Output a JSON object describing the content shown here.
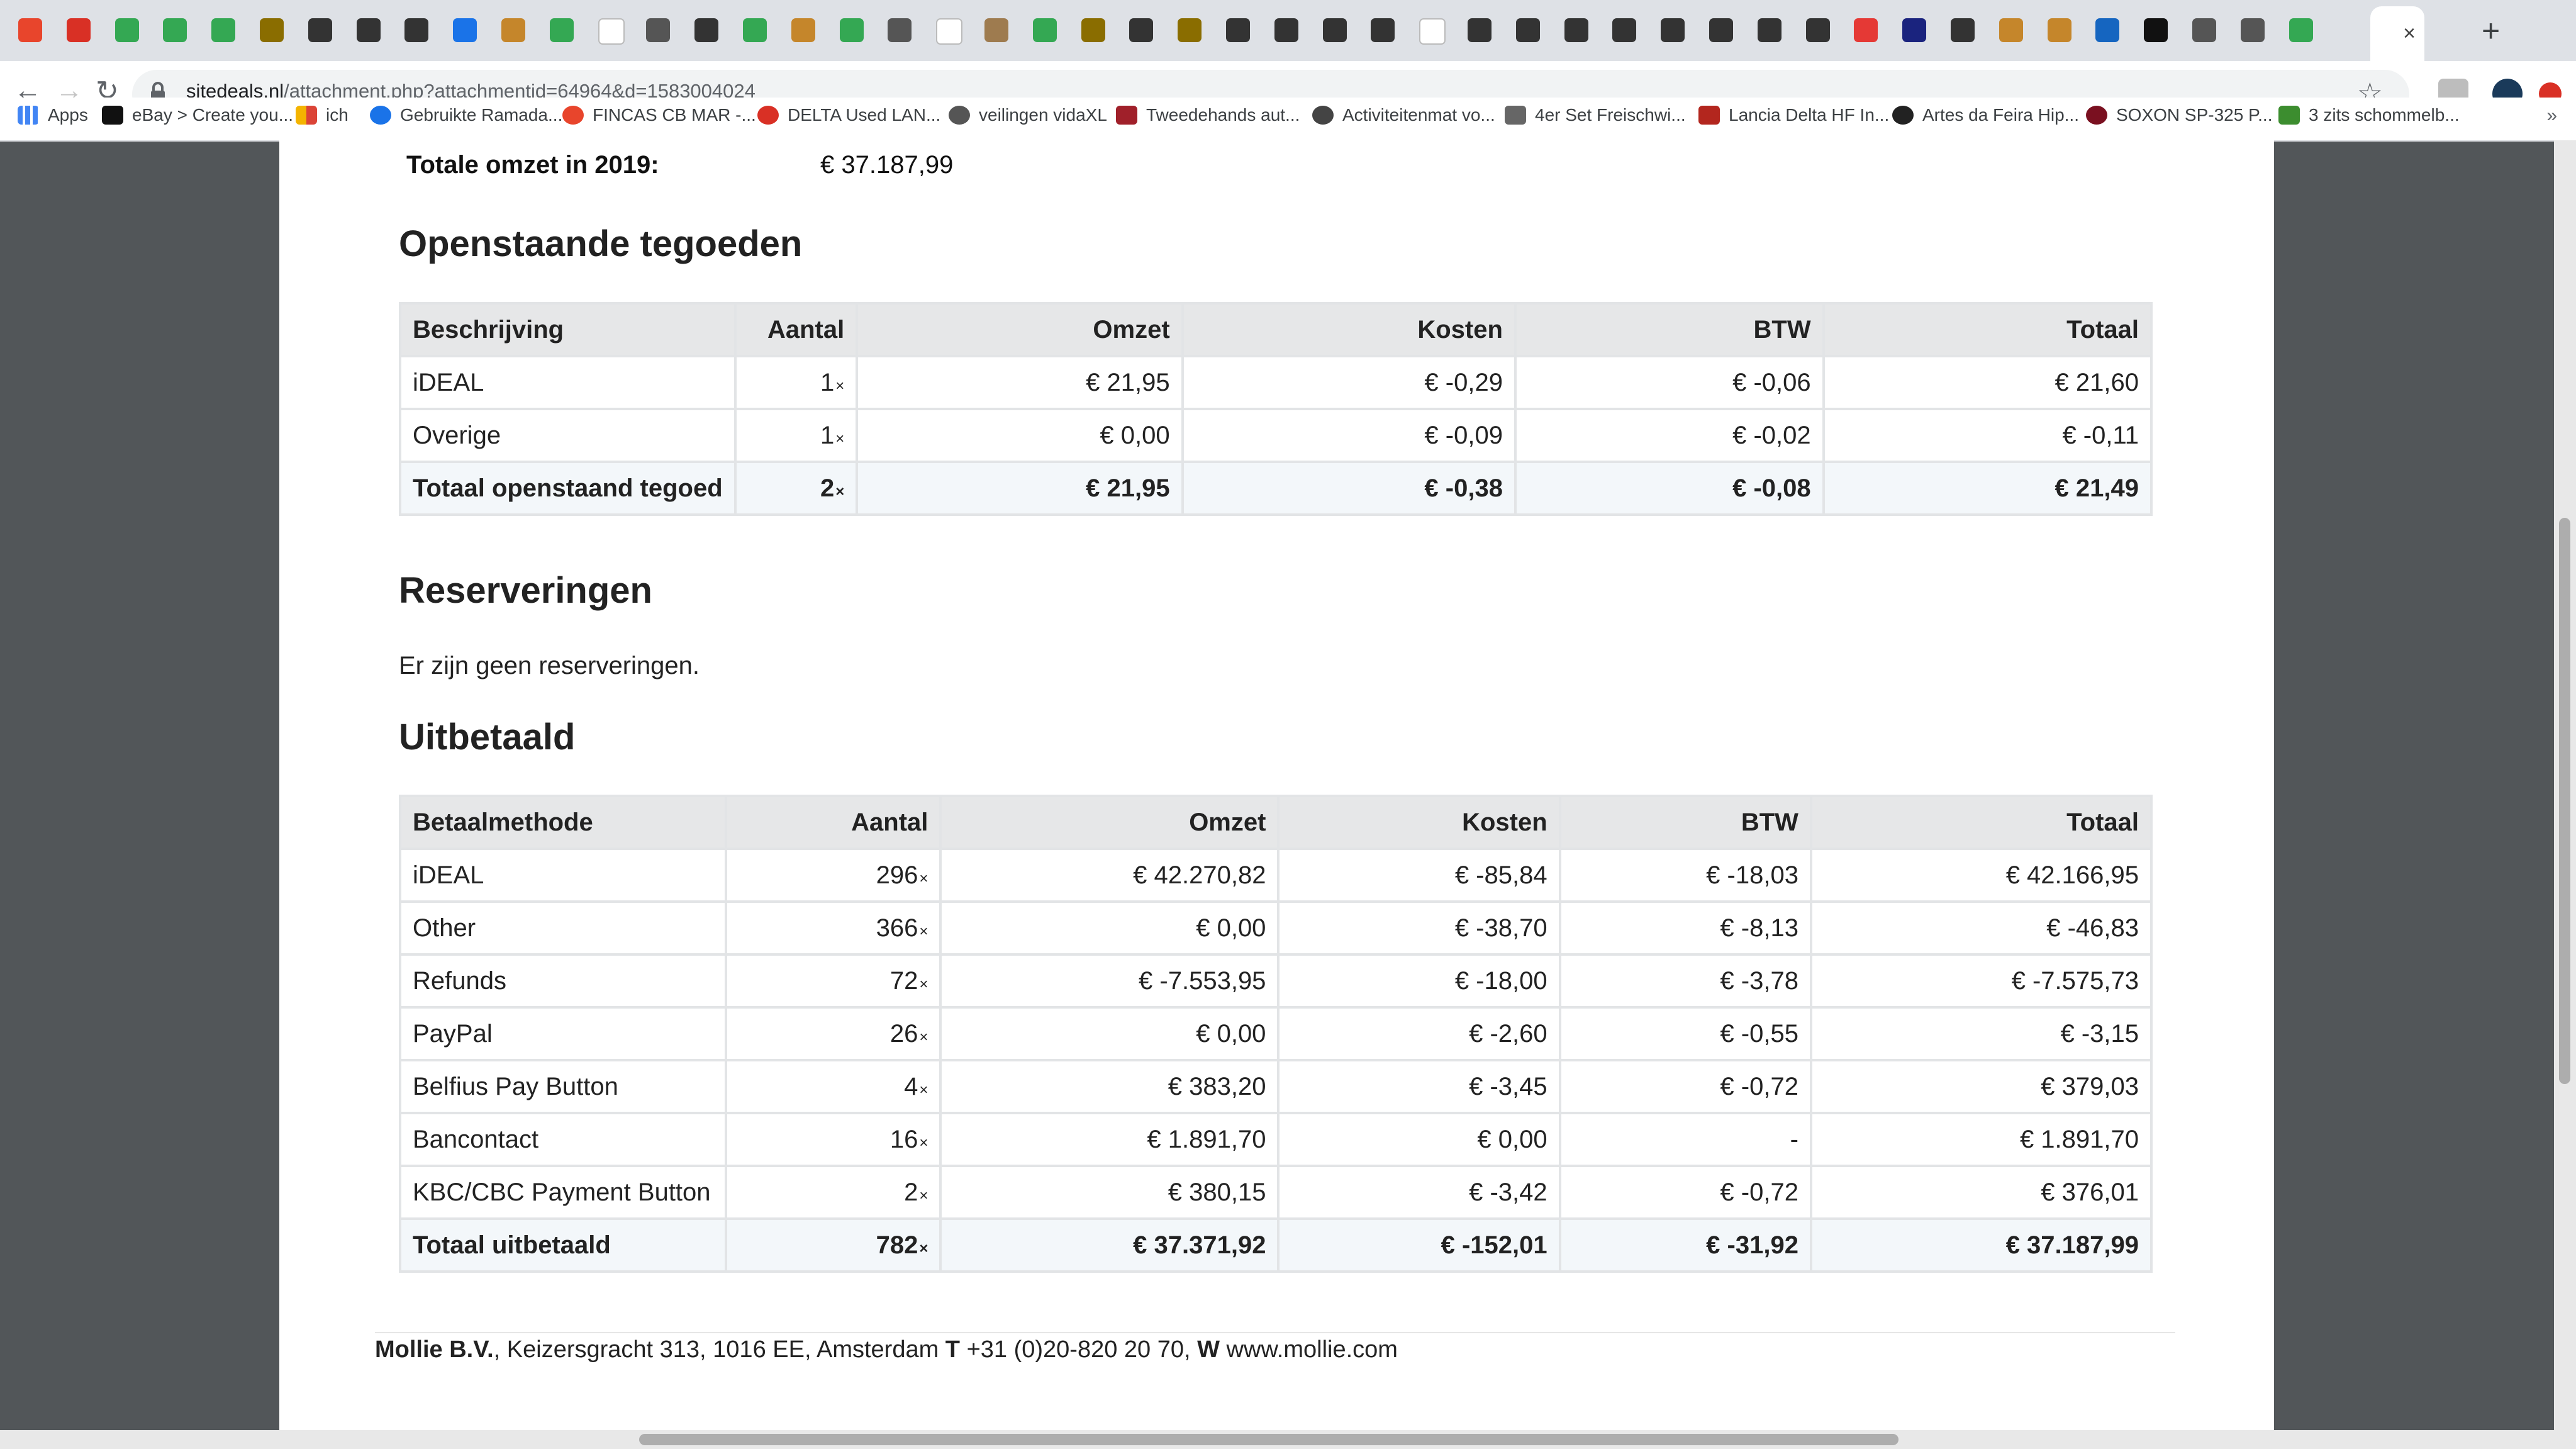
{
  "browser": {
    "active_tab_close": "×",
    "new_tab": "+",
    "url_domain": "sitedeals.nl",
    "url_path": "/attachment.php?attachmentid=64964&d=1583004024",
    "bookmarks": [
      "Apps",
      "eBay > Create you...",
      "ich",
      "Gebruikte Ramada...",
      "FINCAS CB MAR -...",
      "DELTA Used LAN...",
      "veilingen vidaXL",
      "Tweedehands aut...",
      "Activiteitenmat vo...",
      "4er Set Freischwi...",
      "Lancia Delta HF In...",
      "Artes da Feira Hip...",
      "SOXON SP-325 P...",
      "3 zits schommelb..."
    ],
    "bookmarks_more": "»"
  },
  "document": {
    "revenue_label": "Totale omzet in 2019:",
    "revenue_value": "€ 37.187,99",
    "outstanding": {
      "heading": "Openstaande tegoeden",
      "columns": [
        "Beschrijving",
        "Aantal",
        "Omzet",
        "Kosten",
        "BTW",
        "Totaal"
      ],
      "rows": [
        [
          "iDEAL",
          "1",
          "€ 21,95",
          "€ -0,29",
          "€ -0,06",
          "€ 21,60"
        ],
        [
          "Overige",
          "1",
          "€ 0,00",
          "€ -0,09",
          "€ -0,02",
          "€ -0,11"
        ]
      ],
      "total": [
        "Totaal openstaand tegoed",
        "2",
        "€ 21,95",
        "€ -0,38",
        "€ -0,08",
        "€ 21,49"
      ]
    },
    "reservations": {
      "heading": "Reserveringen",
      "text": "Er zijn geen reserveringen."
    },
    "paid": {
      "heading": "Uitbetaald",
      "columns": [
        "Betaalmethode",
        "Aantal",
        "Omzet",
        "Kosten",
        "BTW",
        "Totaal"
      ],
      "rows": [
        [
          "iDEAL",
          "296",
          "€ 42.270,82",
          "€ -85,84",
          "€ -18,03",
          "€ 42.166,95"
        ],
        [
          "Other",
          "366",
          "€ 0,00",
          "€ -38,70",
          "€ -8,13",
          "€ -46,83"
        ],
        [
          "Refunds",
          "72",
          "€ -7.553,95",
          "€ -18,00",
          "€ -3,78",
          "€ -7.575,73"
        ],
        [
          "PayPal",
          "26",
          "€ 0,00",
          "€ -2,60",
          "€ -0,55",
          "€ -3,15"
        ],
        [
          "Belfius Pay Button",
          "4",
          "€ 383,20",
          "€ -3,45",
          "€ -0,72",
          "€ 379,03"
        ],
        [
          "Bancontact",
          "16",
          "€ 1.891,70",
          "€ 0,00",
          "-",
          "€ 1.891,70"
        ],
        [
          "KBC/CBC Payment Button",
          "2",
          "€ 380,15",
          "€ -3,42",
          "€ -0,72",
          "€ 376,01"
        ]
      ],
      "total": [
        "Totaal uitbetaald",
        "782",
        "€ 37.371,92",
        "€ -152,01",
        "€ -31,92",
        "€ 37.187,99"
      ]
    },
    "times_sign": "×",
    "footer": {
      "company": "Mollie B.V.",
      "address": ", Keizersgracht 313, 1016 EE, Amsterdam ",
      "phone_label": "T",
      "phone": " +31 (0)20-820 20 70, ",
      "web_label": "W",
      "web": " www.mollie.com"
    }
  }
}
